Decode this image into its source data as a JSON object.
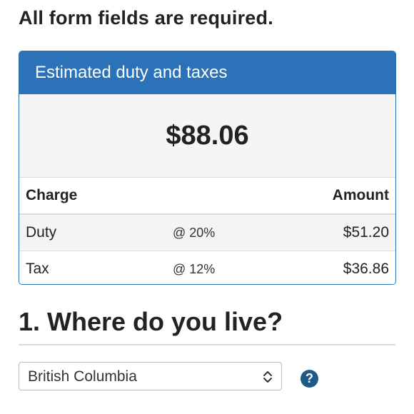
{
  "form": {
    "required_note": "All form fields are required."
  },
  "estimate": {
    "title": "Estimated duty and taxes",
    "total": "$88.06",
    "columns": {
      "charge": "Charge",
      "amount": "Amount"
    },
    "rows": [
      {
        "charge": "Duty",
        "rate": "@ 20%",
        "amount": "$51.20"
      },
      {
        "charge": "Tax",
        "rate": "@ 12%",
        "amount": "$36.86"
      }
    ]
  },
  "question": {
    "title": "1. Where do you live?",
    "select_value": "British Columbia",
    "help_glyph": "?",
    "help_icon": "question-circle-icon"
  },
  "colors": {
    "header_blue": "#2b72b8",
    "help_icon": "#1f5a87"
  }
}
